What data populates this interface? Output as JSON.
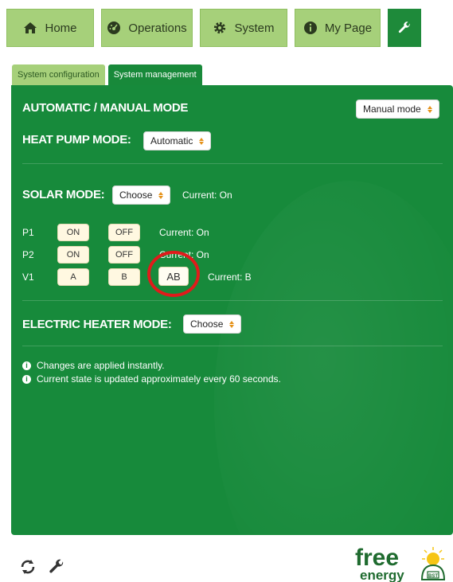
{
  "nav": {
    "home": "Home",
    "operations": "Operations",
    "system": "System",
    "my_page": "My Page"
  },
  "tabs": {
    "config": "System configuration",
    "management": "System management"
  },
  "auto_manual": {
    "title": "AUTOMATIC / MANUAL MODE",
    "value": "Manual mode"
  },
  "heat_pump": {
    "title": "HEAT PUMP MODE:",
    "value": "Automatic"
  },
  "solar": {
    "title": "SOLAR MODE:",
    "value": "Choose",
    "current": "Current: On",
    "p1": {
      "label": "P1",
      "on": "ON",
      "off": "OFF",
      "current": "Current: On"
    },
    "p2": {
      "label": "P2",
      "on": "ON",
      "off": "OFF",
      "current": "Current: On"
    },
    "v1": {
      "label": "V1",
      "a": "A",
      "b": "B",
      "ab": "AB",
      "current": "Current: B"
    }
  },
  "electric_heater": {
    "title": "ELECTRIC HEATER MODE:",
    "value": "Choose"
  },
  "notes": [
    "Changes are applied instantly.",
    "Current state is updated approximately every 60 seconds."
  ],
  "logo": {
    "line1": "free",
    "line2": "energy",
    "mark": "BST"
  },
  "colors": {
    "accent_green": "#178a3b",
    "light_green": "#a6d07a",
    "highlight_red": "#e01b1b"
  }
}
